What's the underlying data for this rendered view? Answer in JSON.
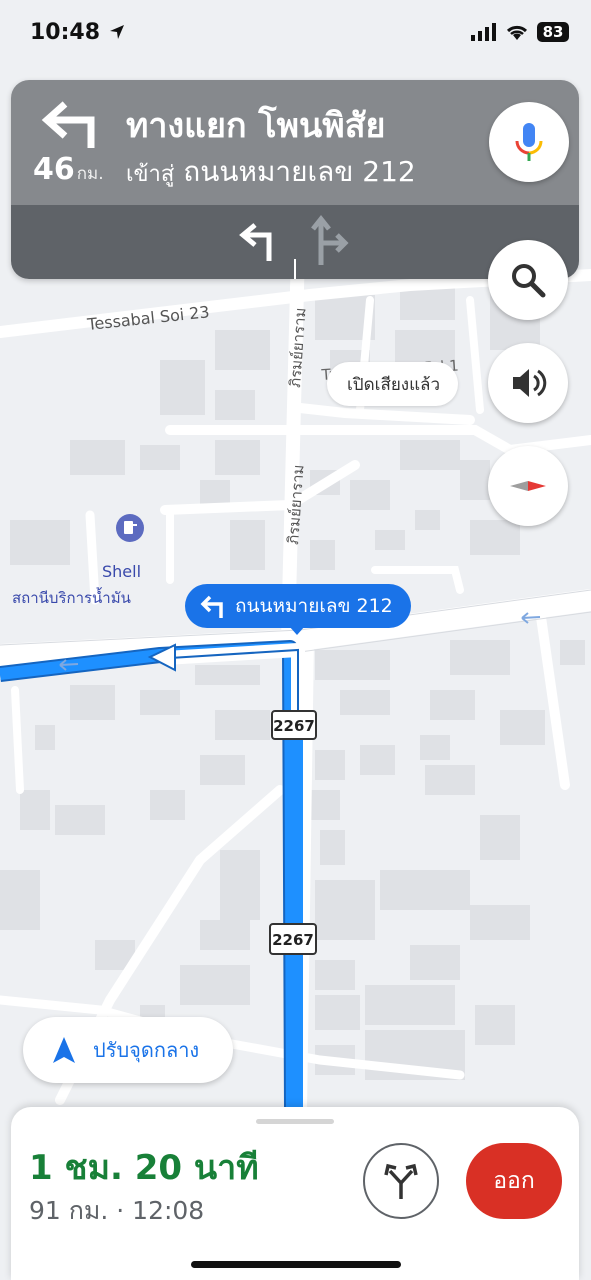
{
  "status": {
    "time": "10:48",
    "battery": "83"
  },
  "nav": {
    "title": "ทางแยก โพนพิสัย",
    "subtitle_prefix": "เข้าสู่",
    "subtitle_road": "ถนนหมายเลข 212",
    "distance": "46",
    "distance_unit": "กม."
  },
  "map": {
    "road_tessabal": "Tessabal Soi 23",
    "road_vertical_1": "ภิรมย์ยาราม",
    "road_vertical_2": "ภิรมย์ยาราม",
    "road_right": "Treedaoprom Rd 1",
    "poi_brand": "Shell",
    "poi_name": "สถานีบริการน้ำมัน",
    "route_label": "ถนนหมายเลข 212",
    "shield_1": "2267",
    "shield_2": "2267"
  },
  "sound_chip": "เปิดเสียงแล้ว",
  "recenter_label": "ปรับจุดกลาง",
  "trip": {
    "duration": "1 ชม. 20 นาที",
    "details": "91 กม. · 12:08",
    "exit_label": "ออก"
  },
  "colors": {
    "route": "#1e90ff",
    "eta": "#188038",
    "exit": "#d93025",
    "accent": "#1a73e8"
  }
}
